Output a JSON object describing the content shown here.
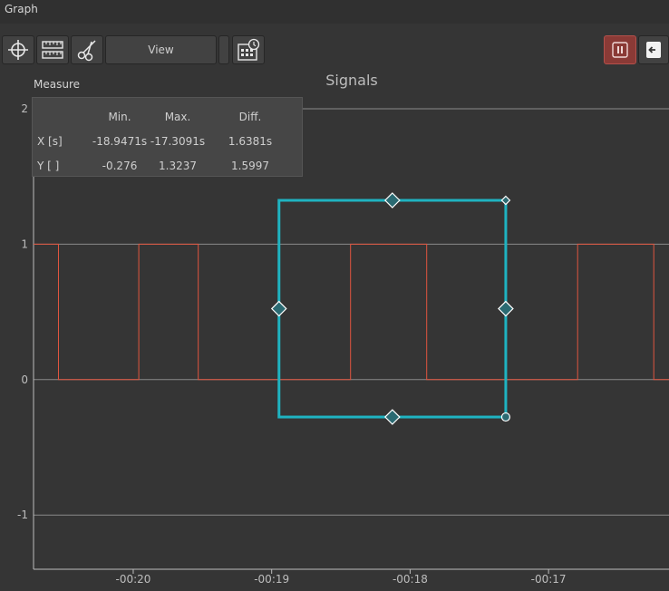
{
  "window": {
    "title": "Graph"
  },
  "toolbar": {
    "buttons": [
      {
        "name": "crosshair-button",
        "icon": "crosshair-icon"
      },
      {
        "name": "ruler-button",
        "icon": "ruler-icon"
      },
      {
        "name": "scissors-button",
        "icon": "scissors-icon"
      }
    ],
    "view_label": "View",
    "history_button_icon": "calendar-clock-icon",
    "pause_button_icon": "pause-icon",
    "exit_button_icon": "exit-icon"
  },
  "measure": {
    "label": "Measure",
    "headers": [
      "Min.",
      "Max.",
      "Diff."
    ],
    "rows": [
      {
        "label": "X [s]",
        "min": "-18.9471s",
        "max": "-17.3091s",
        "diff": "1.6381s"
      },
      {
        "label": "Y [ ]",
        "min": "-0.276",
        "max": "1.3237",
        "diff": "1.5997"
      }
    ]
  },
  "chart_data": {
    "type": "line",
    "title": "Signals",
    "xlabel": "",
    "ylabel": "",
    "x_ticks": [
      "-00:20",
      "-00:19",
      "-00:18",
      "-00:17"
    ],
    "x_tick_values": [
      -20,
      -19,
      -18,
      -17
    ],
    "y_ticks": [
      "2",
      "1",
      "0",
      "-1"
    ],
    "y_tick_values": [
      2,
      1,
      0,
      -1
    ],
    "xlim": [
      -20.72,
      -16.13
    ],
    "ylim": [
      -1.4,
      2.08
    ],
    "grid": "horizontal",
    "series": [
      {
        "color": "#e0553f",
        "step": true,
        "x": [
          -20.72,
          -20.54,
          -20.54,
          -19.96,
          -19.96,
          -19.53,
          -19.53,
          -18.43,
          -18.43,
          -17.88,
          -17.88,
          -16.79,
          -16.79,
          -16.24,
          -16.24,
          -16.13
        ],
        "y": [
          1,
          1,
          0,
          0,
          1,
          1,
          0,
          0,
          1,
          1,
          0,
          0,
          1,
          1,
          0,
          0
        ]
      }
    ],
    "measure_box": {
      "color": "#1fb3c1",
      "x_min": -18.9471,
      "x_max": -17.3091,
      "y_min": -0.276,
      "y_max": 1.3237
    },
    "colors": {
      "background": "#353535",
      "axis": "#bdbdbd",
      "grid": "#8a8a8a"
    }
  }
}
